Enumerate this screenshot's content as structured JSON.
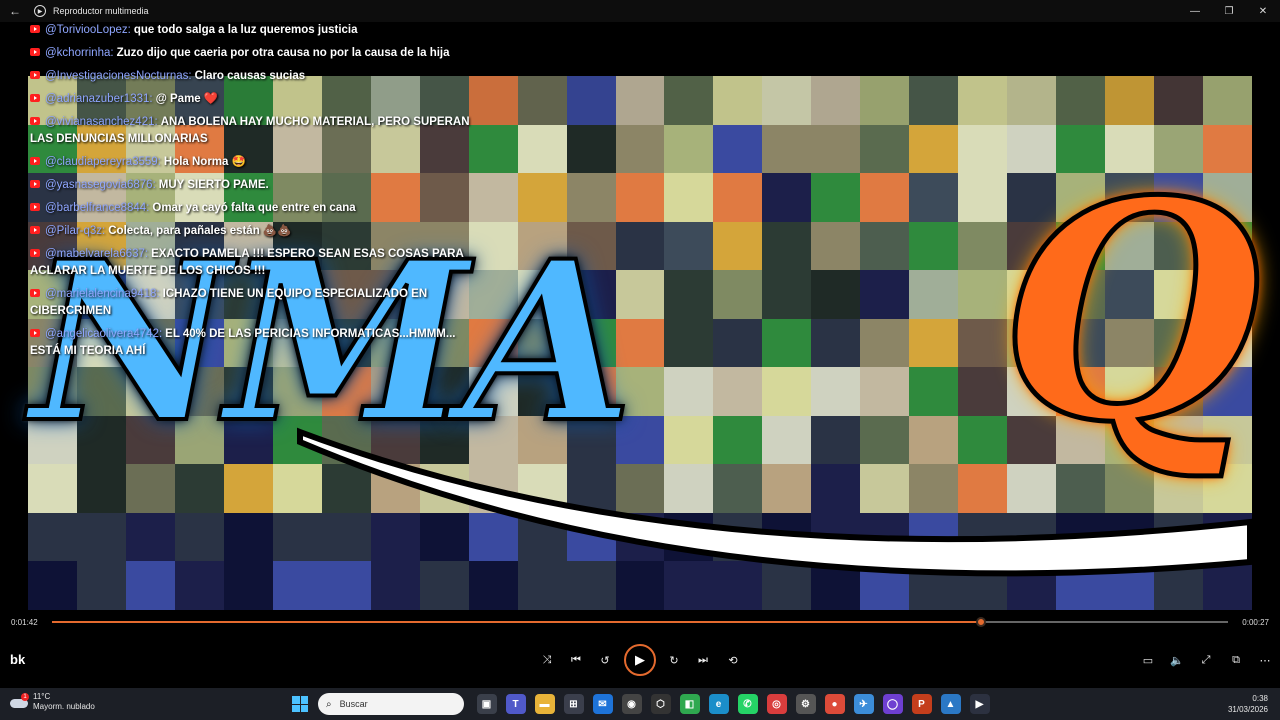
{
  "window": {
    "title": "Reproductor multimedia"
  },
  "chat": [
    {
      "user": "@ToriviooLopez:",
      "message": "que todo salga a la luz queremos justicia"
    },
    {
      "user": "@kchorrinha:",
      "message": "Zuzo dijo que caeria por otra causa no por la causa de la hija"
    },
    {
      "user": "@InvestigacionesNocturnas:",
      "message": "Claro causas sucias"
    },
    {
      "user": "@adrianazuber1331:",
      "message": "@ Pame ❤️"
    },
    {
      "user": "@vivianasanchez421:",
      "message": "ANA BOLENA HAY MUCHO MATERIAL, PERO SUPERAN LAS DENUNCIAS MILLONARIAS"
    },
    {
      "user": "@claudiapereyra3559:",
      "message": "Hola Norma 🤩"
    },
    {
      "user": "@yasnasegovia6876:",
      "message": "MUY SIERTO PAME."
    },
    {
      "user": "@barbelfrance8844:",
      "message": "Omar ya cayó falta que entre en cana"
    },
    {
      "user": "@Pilar-q3z:",
      "message": "Colecta, para pañales están 💩💩"
    },
    {
      "user": "@mabelvarela6637:",
      "message": "EXACTO PAMELA !!! ESPERO SEAN ESAS COSAS PARA ACLARAR LA MUERTE DE LOS CHICOS !!!"
    },
    {
      "user": "@marielalencina9418:",
      "message": "ICHAZO TIENE UN EQUIPO ESPECIALIZADO EN CIBERCRIMEN"
    },
    {
      "user": "@angelicaolivera4742:",
      "message": "EL 40% DE LAS PERICIAS INFORMATICAS...HMMM... ESTÁ MI TEORIA AHÍ"
    }
  ],
  "video": {
    "logo_text": "NMA",
    "logo_q": "Q"
  },
  "player": {
    "elapsed": "0:01:42",
    "remaining": "0:00:27",
    "progress_fraction": 0.79,
    "track_label": "bk",
    "accent_color": "#e46a2e",
    "buttons": [
      "shuffle-icon",
      "previous-icon",
      "rewind-10-icon",
      "play-icon",
      "forward-30-icon",
      "next-icon",
      "repeat-off-icon",
      "miniplayer-icon",
      "volume-icon",
      "fullscreen-icon",
      "cast-icon",
      "more-icon"
    ]
  },
  "taskbar": {
    "weather_temp": "11°C",
    "weather_desc": "Mayorm. nublado",
    "weather_badge": "1",
    "search_placeholder": "Buscar",
    "time": "0:38",
    "date": "31/03/2026"
  }
}
